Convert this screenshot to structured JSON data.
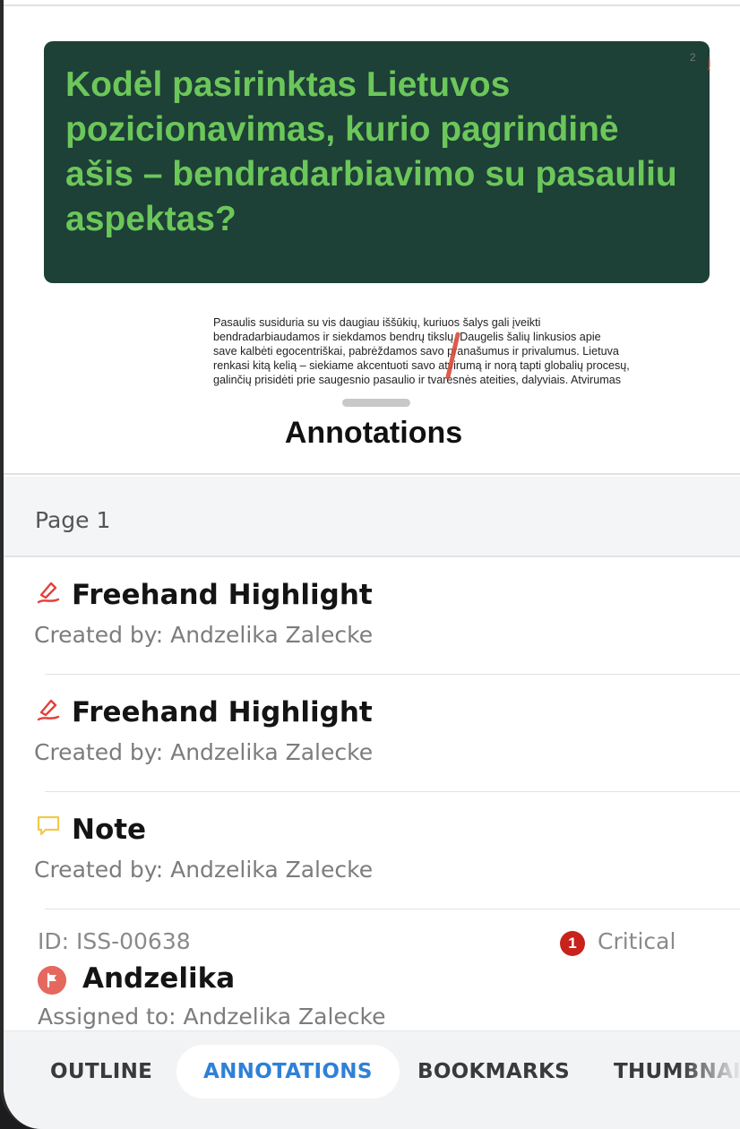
{
  "document": {
    "slide_title": "Kodėl pasirinktas Lietuvos pozicionavimas, kurio pagrindinė ašis – bendradarbiavimo su pasauliu aspektas?",
    "page_number": "2",
    "side_mark": "į",
    "paragraph_lines": [
      "Pasaulis susiduria su vis daugiau iššūkių, kuriuos šalys gali įveikti",
      "bendradarbiaudamos ir siekdamos bendrų tikslų. Daugelis šalių linkusios apie",
      "save kalbėti egocentriškai, pabrėždamos savo pranašumus ir privalumus. Lietuva",
      "renkasi kitą kelią – siekiame akcentuoti savo atvirumą ir norą tapti globalių procesų,",
      "galinčių prisidėti prie saugesnio pasaulio ir tvaresnės ateities, dalyviais. Atvirumas"
    ],
    "highlight_color": "#d84a3a",
    "slide_bg": "#1d4037",
    "slide_text_color": "#6cc75a"
  },
  "sheet": {
    "title": "Annotations"
  },
  "section": {
    "label": "Page 1"
  },
  "annotations": [
    {
      "title": "Freehand Highlight",
      "subtitle": "Created by: Andzelika Zalecke",
      "icon": "freehand-highlight-icon",
      "icon_color": "#e5403a"
    },
    {
      "title": "Freehand Highlight",
      "subtitle": "Created by: Andzelika Zalecke",
      "icon": "freehand-highlight-icon",
      "icon_color": "#e5403a"
    },
    {
      "title": "Note",
      "subtitle": "Created by: Andzelika Zalecke",
      "icon": "note-comment-icon",
      "icon_color": "#f2c94c"
    }
  ],
  "issue": {
    "id": "ID: ISS-00638",
    "severity_count": "1",
    "severity": "Critical",
    "severity_color": "#c8221d",
    "name": "Andzelika",
    "assigned": "Assigned to: Andzelika Zalecke",
    "icon": "flag-icon"
  },
  "tabs": [
    {
      "label": "OUTLINE",
      "active": false
    },
    {
      "label": "ANNOTATIONS",
      "active": true
    },
    {
      "label": "BOOKMARKS",
      "active": false
    },
    {
      "label": "THUMBNAILS",
      "active": false
    }
  ],
  "accent_color": "#2f80d8"
}
